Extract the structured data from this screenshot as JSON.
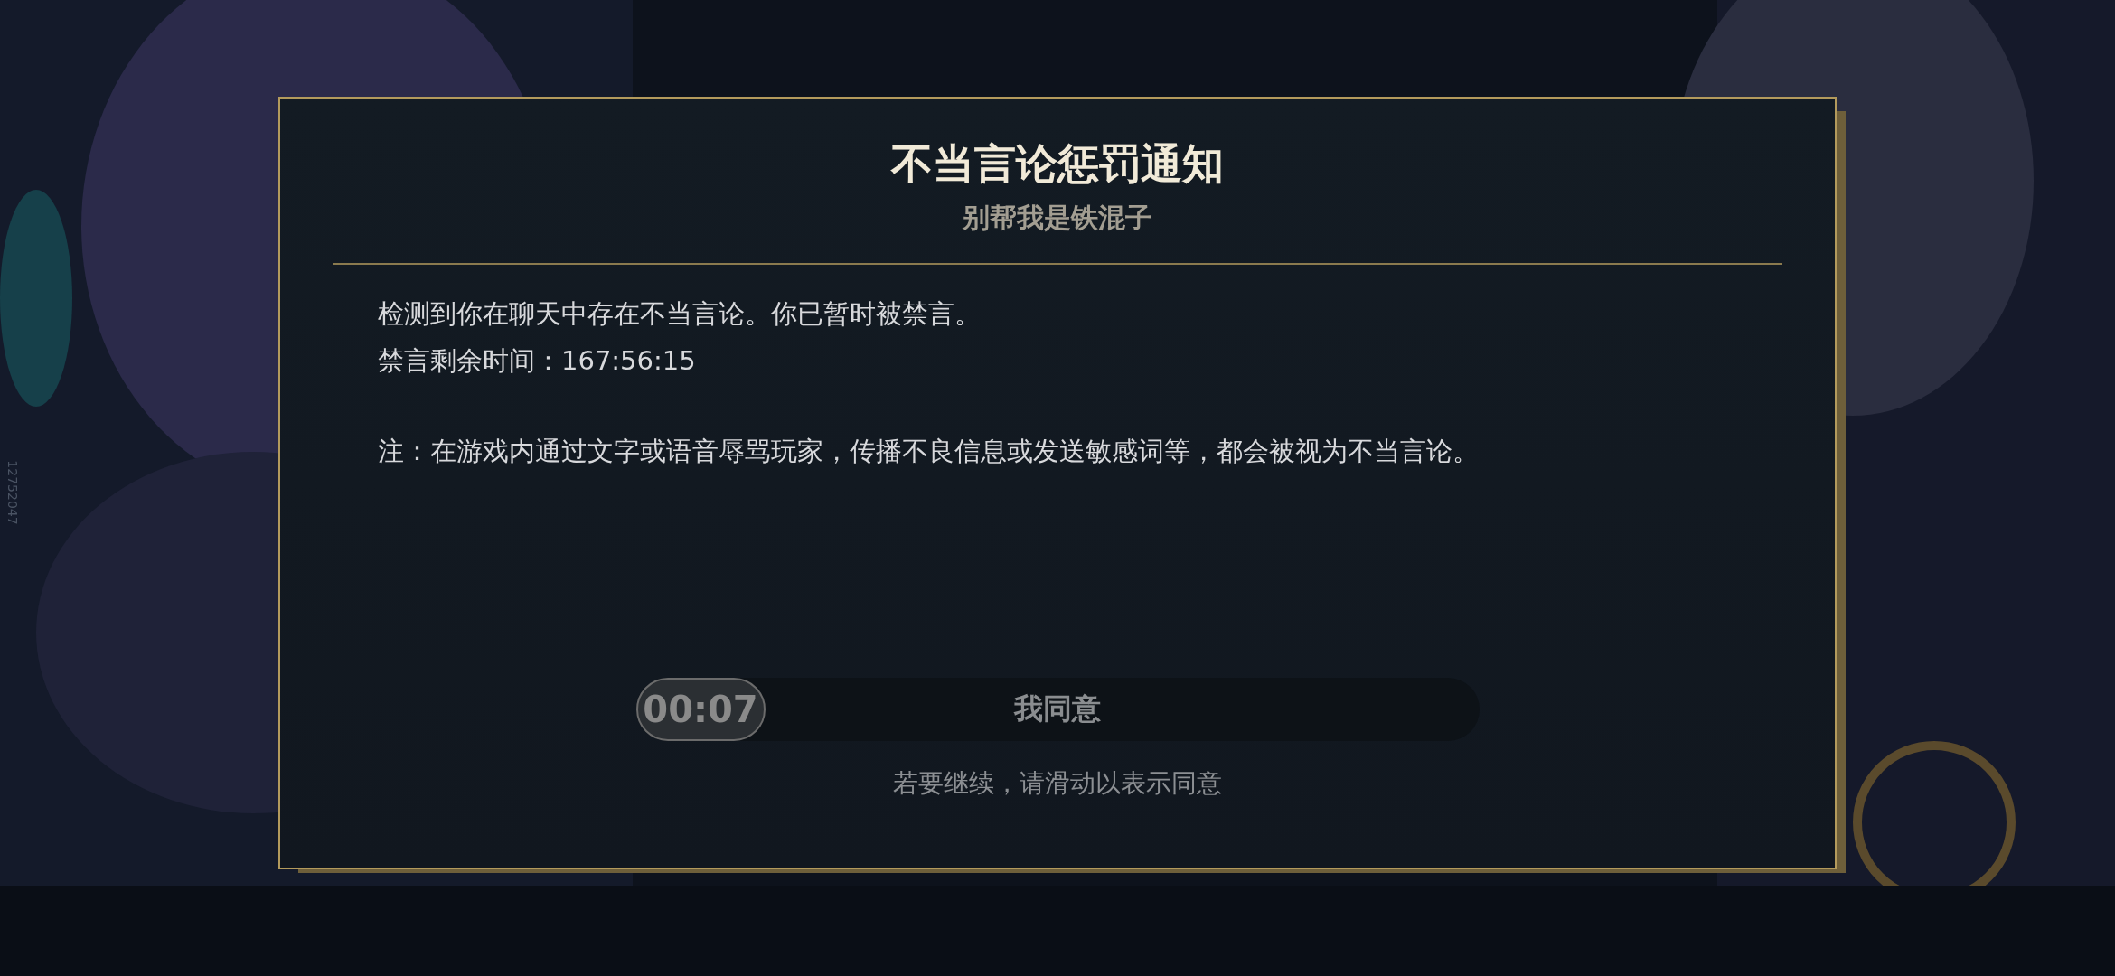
{
  "side_label": "12752047",
  "dialog": {
    "title": "不当言论惩罚通知",
    "subtitle": "别帮我是铁混子",
    "message": [
      "检测到你在聊天中存在不当言论。你已暂时被禁言。",
      "禁言剩余时间：167:56:15"
    ],
    "note": "注：在游戏内通过文字或语音辱骂玩家，传播不良信息或发送敏感词等，都会被视为不当言论。",
    "slider": {
      "countdown": "00:07",
      "label": "我同意",
      "level": 0
    },
    "hint": "若要继续，请滑动以表示同意"
  }
}
